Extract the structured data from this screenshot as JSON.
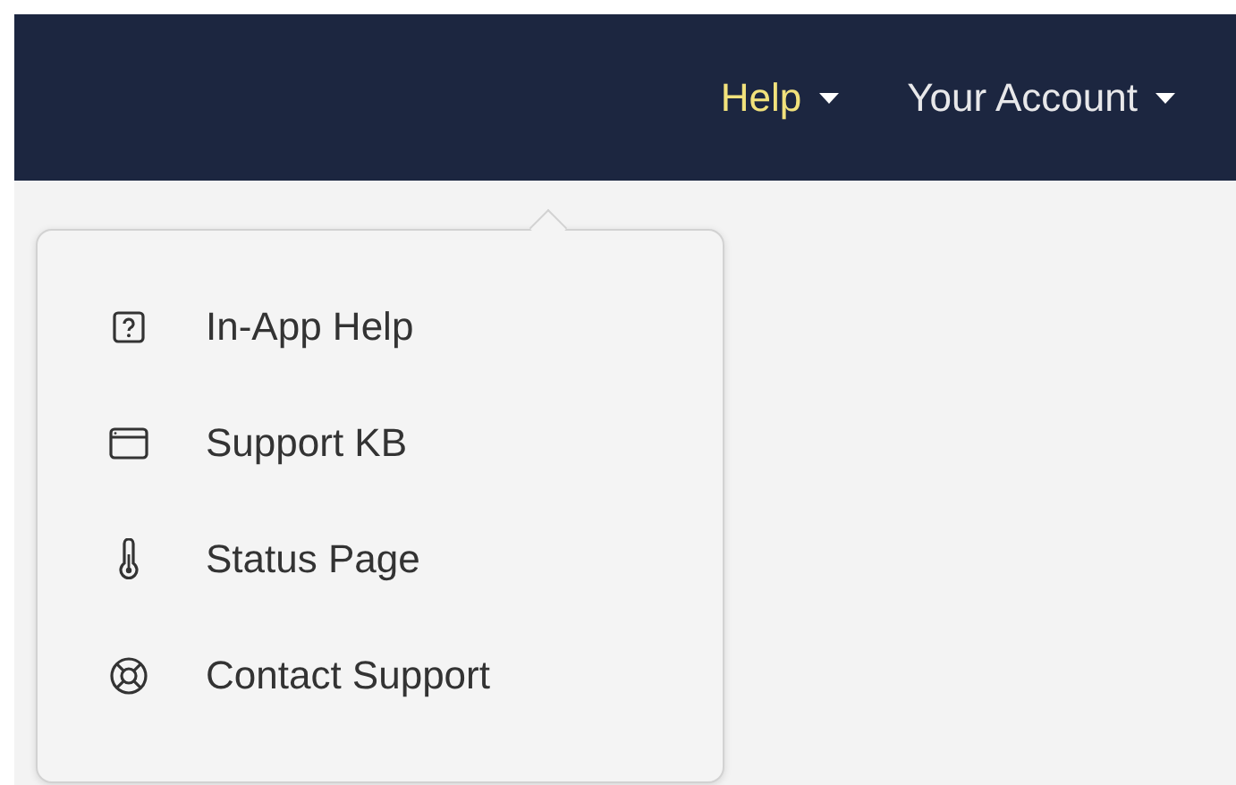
{
  "navbar": {
    "items": [
      {
        "label": "Help",
        "selected": true
      },
      {
        "label": "Your Account",
        "selected": false
      }
    ]
  },
  "help_menu": {
    "items": [
      {
        "label": "In-App Help",
        "kind": "help"
      },
      {
        "label": "Support KB",
        "kind": "window"
      },
      {
        "label": "Status Page",
        "kind": "thermometer"
      },
      {
        "label": "Contact Support",
        "kind": "lifebuoy"
      }
    ]
  }
}
